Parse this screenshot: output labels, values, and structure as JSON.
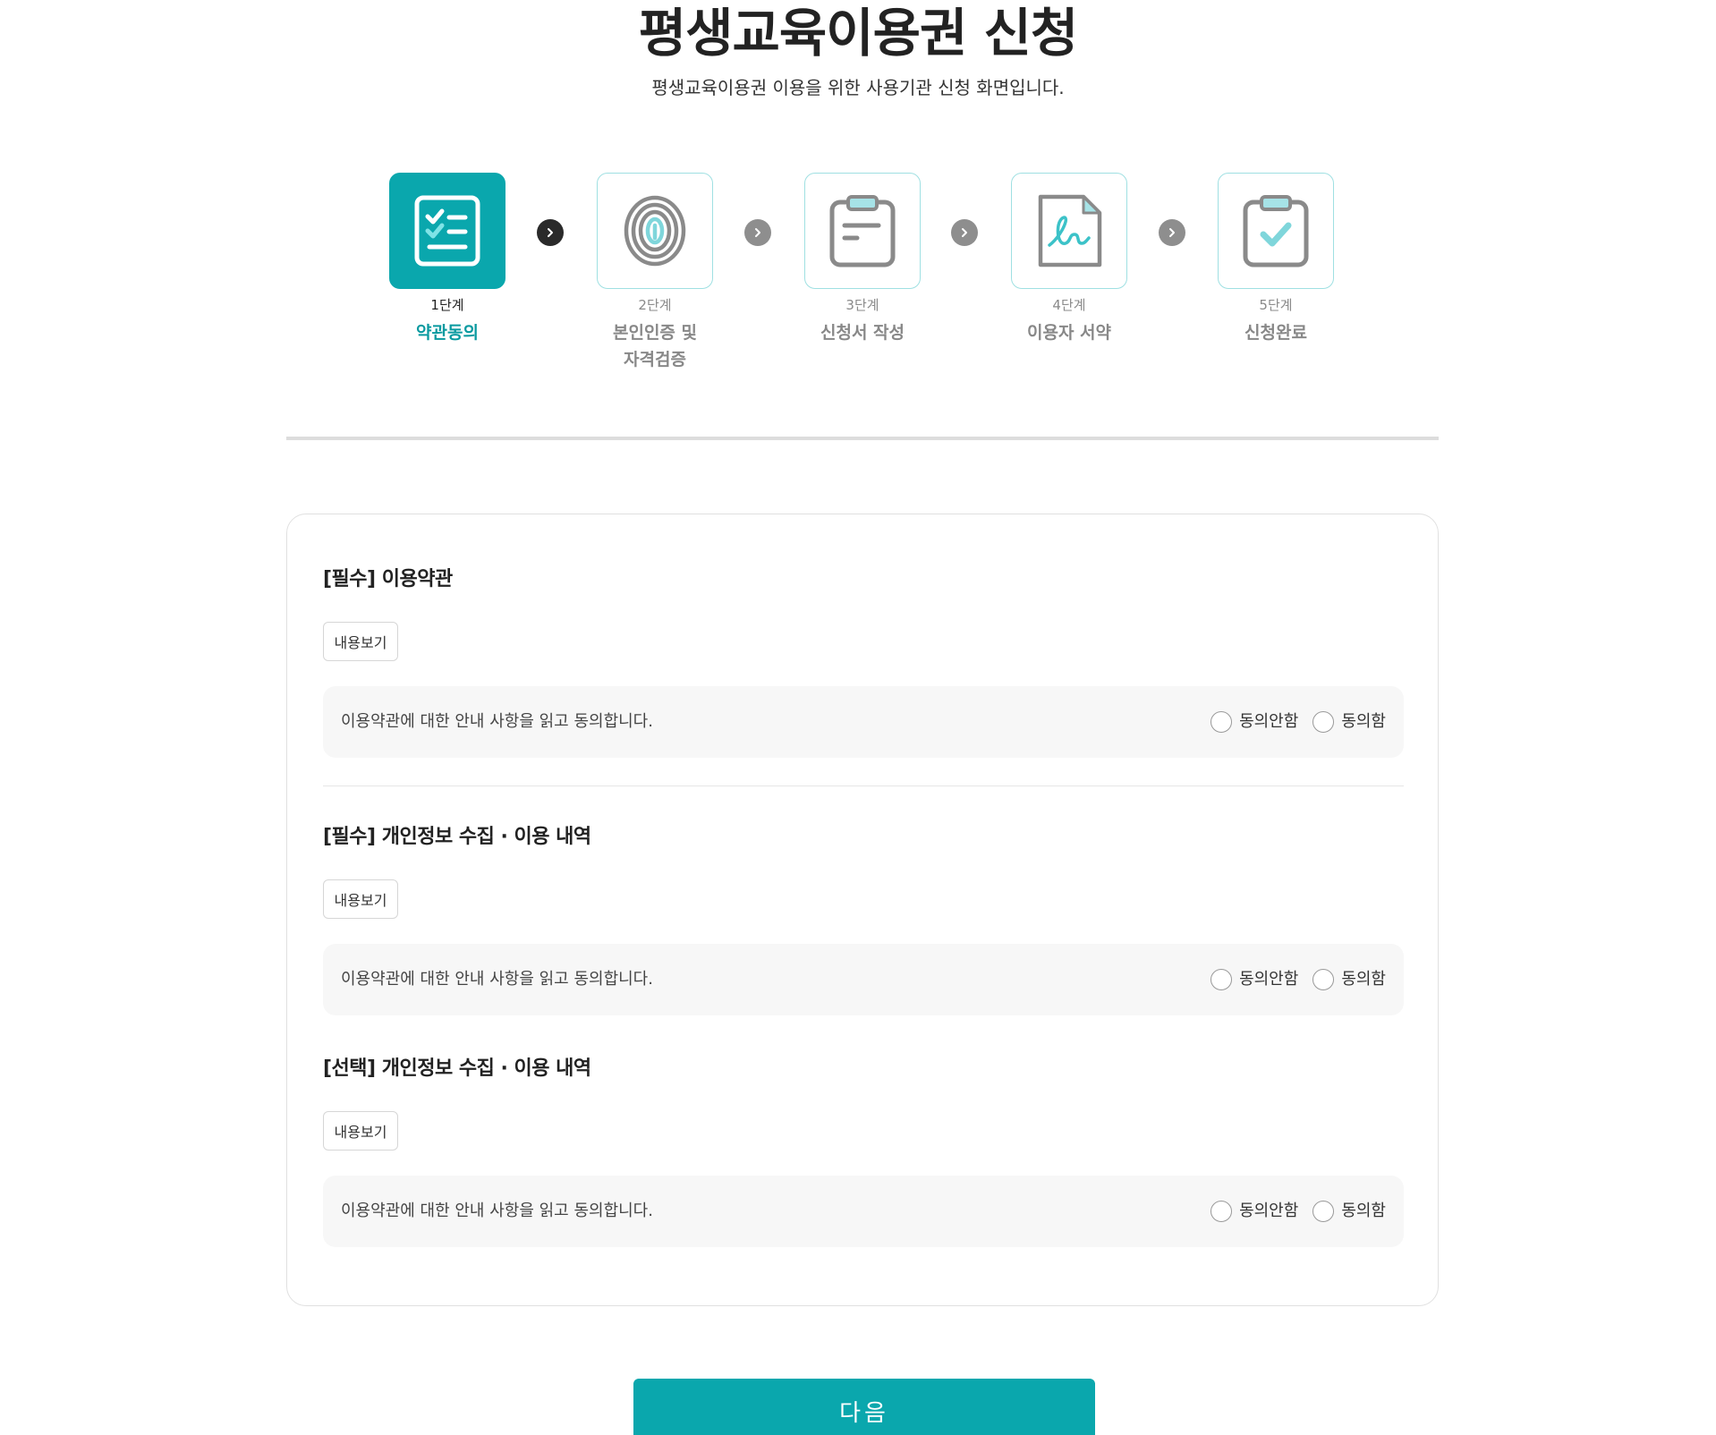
{
  "header": {
    "title": "평생교육이용권 신청",
    "subtitle": "평생교육이용권 이용을 위한 사용기관 신청 화면입니다."
  },
  "steps": [
    {
      "num": "1단계",
      "label": "약관동의",
      "active": true
    },
    {
      "num": "2단계",
      "label": "본인인증 및 자격검증",
      "label_line1": "본인인증 및",
      "label_line2": "자격검증",
      "active": false
    },
    {
      "num": "3단계",
      "label": "신청서 작성",
      "active": false
    },
    {
      "num": "4단계",
      "label": "이용자 서약",
      "active": false
    },
    {
      "num": "5단계",
      "label": "신청완료",
      "active": false
    }
  ],
  "sections": [
    {
      "title": "[필수] 이용약관",
      "view_label": "내용보기",
      "agree_text": "이용약관에 대한 안내 사항을 읽고 동의합니다.",
      "disagree_label": "동의안함",
      "agree_label": "동의함"
    },
    {
      "title": "[필수] 개인정보 수집 · 이용 내역",
      "view_label": "내용보기",
      "agree_text": "이용약관에 대한 안내 사항을 읽고 동의합니다.",
      "disagree_label": "동의안함",
      "agree_label": "동의함"
    },
    {
      "title": "[선택] 개인정보 수집 · 이용 내역",
      "view_label": "내용보기",
      "agree_text": "이용약관에 대한 안내 사항을 읽고 동의합니다.",
      "disagree_label": "동의안함",
      "agree_label": "동의함"
    }
  ],
  "next_button": "다음",
  "colors": {
    "accent": "#0aa7ad",
    "accent_light": "#9fe0e2",
    "icon_gray": "#8a8a8a"
  }
}
